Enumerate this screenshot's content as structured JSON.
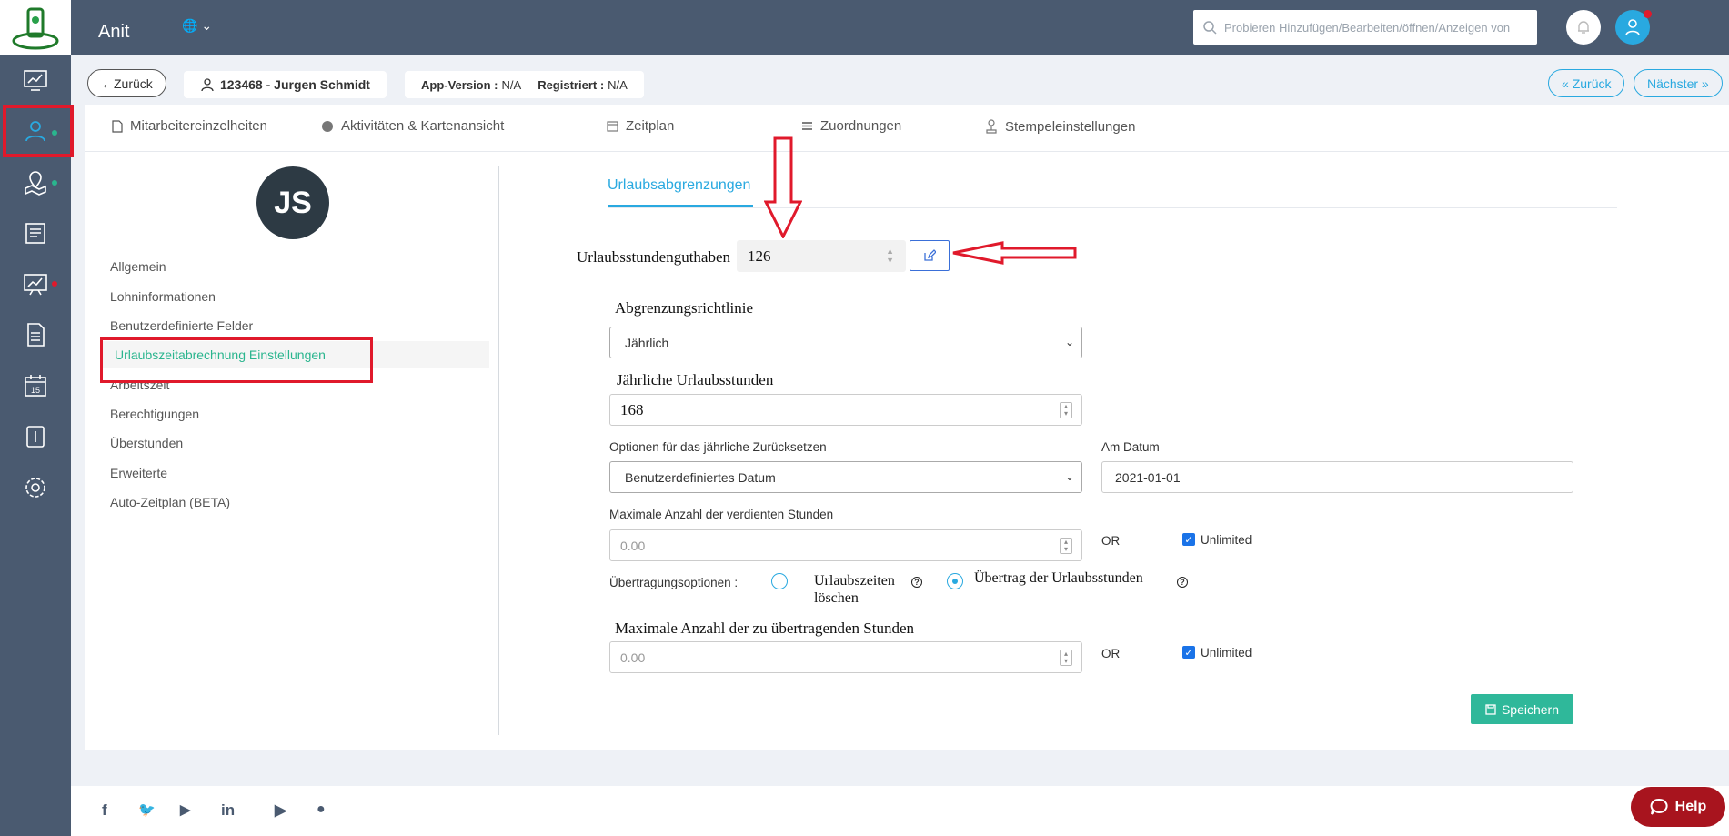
{
  "header": {
    "app_name": "Anit",
    "search_placeholder": "Probieren Hinzufügen/Bearbeiten/öffnen/Anzeigen von"
  },
  "crumbs": {
    "back_label": "Zurück",
    "employee": "123468 - Jurgen Schmidt",
    "app_version_label": "App-Version :",
    "app_version_value": "N/A",
    "registered_label": "Registriert :",
    "registered_value": "N/A",
    "prev_label": "Zurück",
    "next_label": "Nächster"
  },
  "tabs": [
    {
      "label": "Mitarbeitereinzelheiten",
      "icon": "file-icon"
    },
    {
      "label": "Aktivitäten & Kartenansicht",
      "icon": "globe-icon"
    },
    {
      "label": "Zeitplan",
      "icon": "calendar-icon"
    },
    {
      "label": "Zuordnungen",
      "icon": "list-icon"
    },
    {
      "label": "Stempeleinstellungen",
      "icon": "stamp-icon"
    }
  ],
  "profile": {
    "initials": "JS"
  },
  "menu": [
    "Allgemein",
    "Lohninformationen",
    "Benutzerdefinierte Felder",
    "Urlaubszeitabrechnung Einstellungen",
    "Arbeitszeit",
    "Berechtigungen",
    "Überstunden",
    "Erweiterte",
    "Auto-Zeitplan (BETA)"
  ],
  "form": {
    "subtab": "Urlaubsabgrenzungen",
    "balance_label": "Urlaubsstundenguthaben",
    "balance_value": "126",
    "policy_label": "Abgrenzungsrichtlinie",
    "policy_value": "Jährlich",
    "annual_hours_label": "Jährliche Urlaubsstunden",
    "annual_hours_value": "168",
    "reset_label": "Optionen für das jährliche Zurücksetzen",
    "reset_value": "Benutzerdefiniertes Datum",
    "date_label": "Am Datum",
    "date_value": "2021-01-01",
    "max_earned_label": "Maximale Anzahl der verdienten Stunden",
    "max_earned_placeholder": "0.00",
    "or_label": "OR",
    "unlimited_label": "Unlimited",
    "transfer_label": "Übertragungsoptionen :",
    "transfer_opt1": "Urlaubszeiten löschen",
    "transfer_opt2": "Übertrag der Urlaubsstunden",
    "max_transfer_label": "Maximale Anzahl der zu übertragenden Stunden",
    "max_transfer_placeholder": "0.00",
    "save_label": "Speichern"
  },
  "help_label": "Help",
  "colors": {
    "sidebar": "#4a5a70",
    "accent": "#29a9e0",
    "save": "#2fb89a",
    "annotation_red": "#e0192b"
  }
}
